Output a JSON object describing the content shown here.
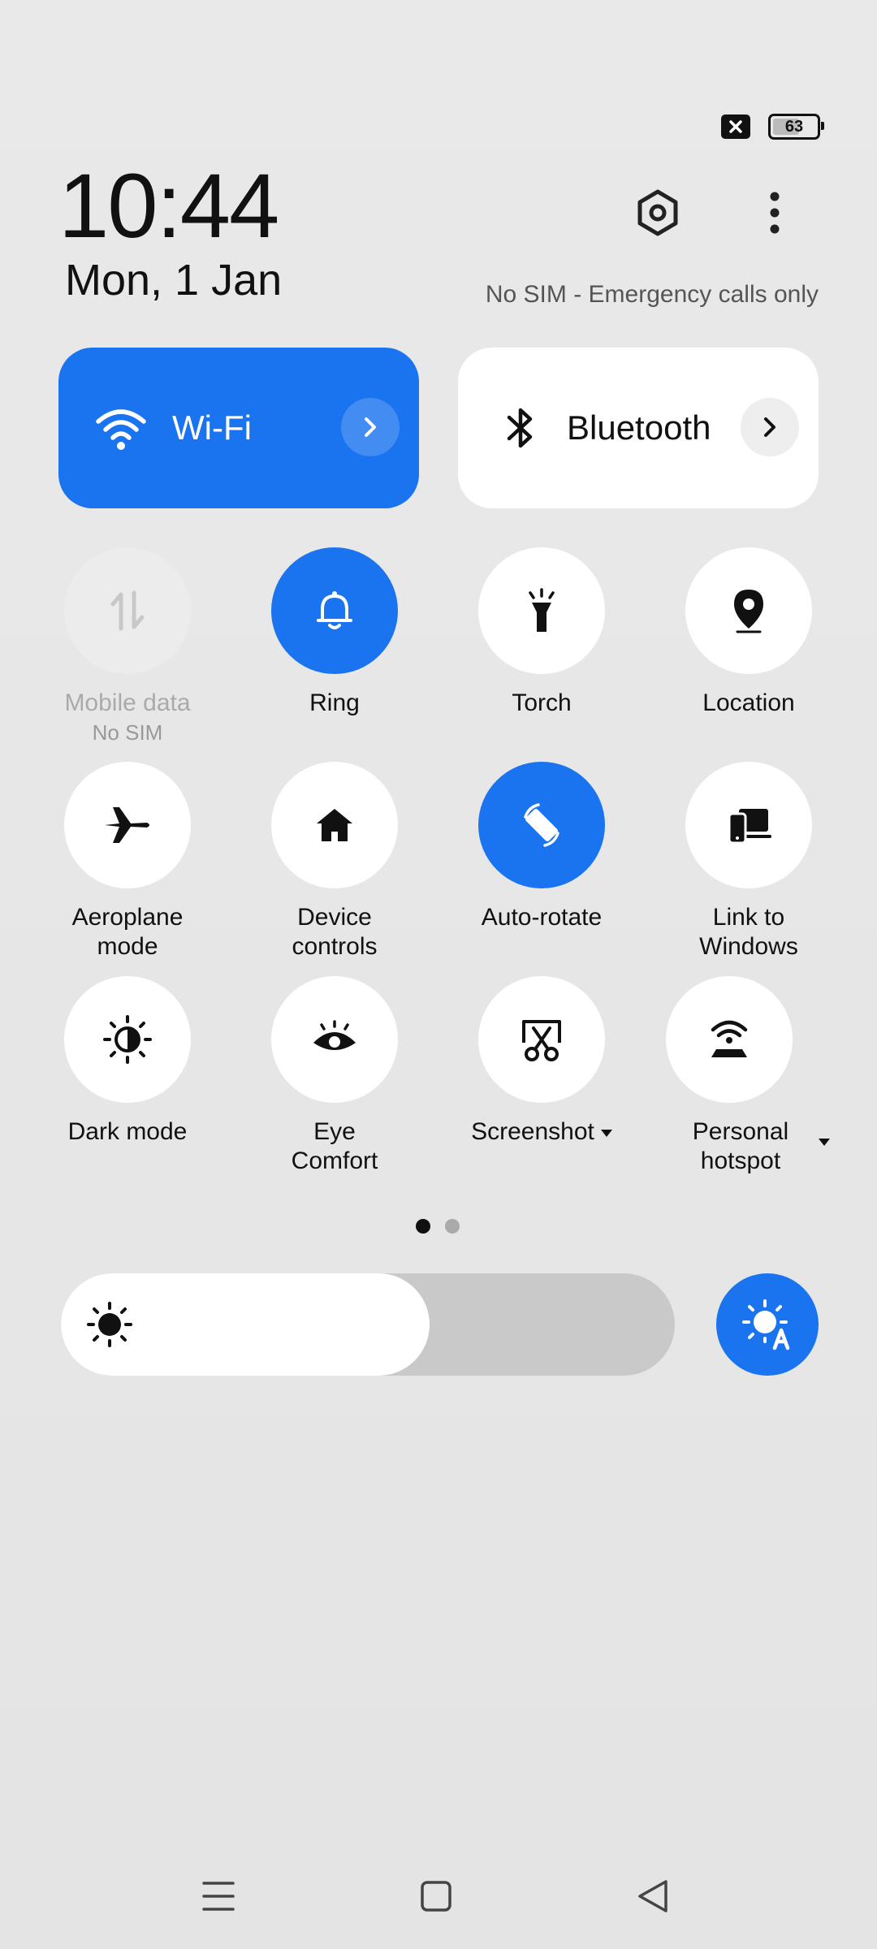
{
  "status": {
    "battery_level": "63"
  },
  "header": {
    "time": "10:44",
    "date": "Mon, 1 Jan",
    "sim_status": "No SIM - Emergency calls only"
  },
  "big_tiles": {
    "wifi": {
      "label": "Wi-Fi",
      "state": "on"
    },
    "bluetooth": {
      "label": "Bluetooth",
      "state": "off"
    }
  },
  "tiles": [
    {
      "label": "Mobile data",
      "sub": "No SIM",
      "state": "disabled",
      "icon": "mobile-data-icon"
    },
    {
      "label": "Ring",
      "state": "on",
      "icon": "bell-icon"
    },
    {
      "label": "Torch",
      "state": "off",
      "icon": "torch-icon"
    },
    {
      "label": "Location",
      "state": "off",
      "icon": "location-pin-icon"
    },
    {
      "label": "Aeroplane",
      "label2": "mode",
      "state": "off",
      "icon": "aeroplane-icon"
    },
    {
      "label": "Device",
      "label2": "controls",
      "state": "off",
      "icon": "home-icon"
    },
    {
      "label": "Auto-rotate",
      "state": "on",
      "icon": "auto-rotate-icon"
    },
    {
      "label": "Link to",
      "label2": "Windows",
      "state": "off",
      "icon": "link-to-windows-icon"
    },
    {
      "label": "Dark mode",
      "state": "off",
      "icon": "dark-mode-icon"
    },
    {
      "label": "Eye",
      "label2": "Comfort",
      "state": "off",
      "icon": "eye-icon"
    },
    {
      "label": "Screenshot",
      "state": "off",
      "icon": "screenshot-icon"
    },
    {
      "label": "Personal",
      "label2": "hotspot",
      "state": "off",
      "icon": "hotspot-icon"
    }
  ],
  "pager": {
    "pages": 2,
    "current": 1
  },
  "brightness": {
    "level_percent": 60,
    "auto": true
  },
  "colors": {
    "accent": "#1a73ef",
    "tile_off": "#ffffff",
    "background": "#e8e8e8"
  }
}
